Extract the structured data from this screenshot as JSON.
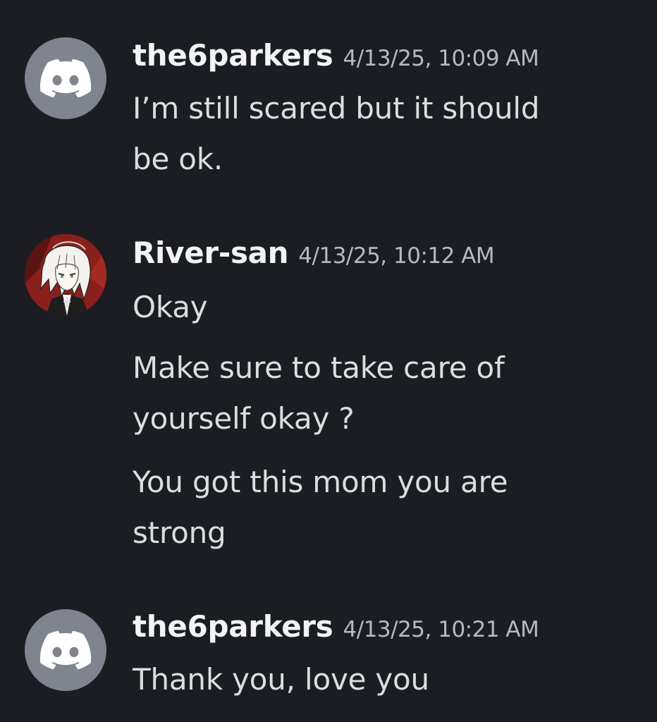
{
  "messages": [
    {
      "username": "the6parkers",
      "timestamp": "4/13/25, 10:09 AM",
      "avatar_icon": "discord-logo-icon",
      "lines": [
        "I’m still scared but it should\nbe ok."
      ]
    },
    {
      "username": "River-san",
      "timestamp": "4/13/25, 10:12 AM",
      "avatar_icon": "anime-character-avatar",
      "lines": [
        "Okay",
        "Make sure to take care of\nyourself okay ?",
        "You got this mom you are\nstrong"
      ]
    },
    {
      "username": "the6parkers",
      "timestamp": "4/13/25, 10:21 AM",
      "avatar_icon": "discord-logo-icon",
      "lines": [
        "Thank you, love you"
      ]
    }
  ],
  "colors": {
    "background": "#1c1d22",
    "username": "#f2f3f5",
    "timestamp": "#b5bac1",
    "message_text": "#dbdee1",
    "default_avatar": "#80848e"
  }
}
